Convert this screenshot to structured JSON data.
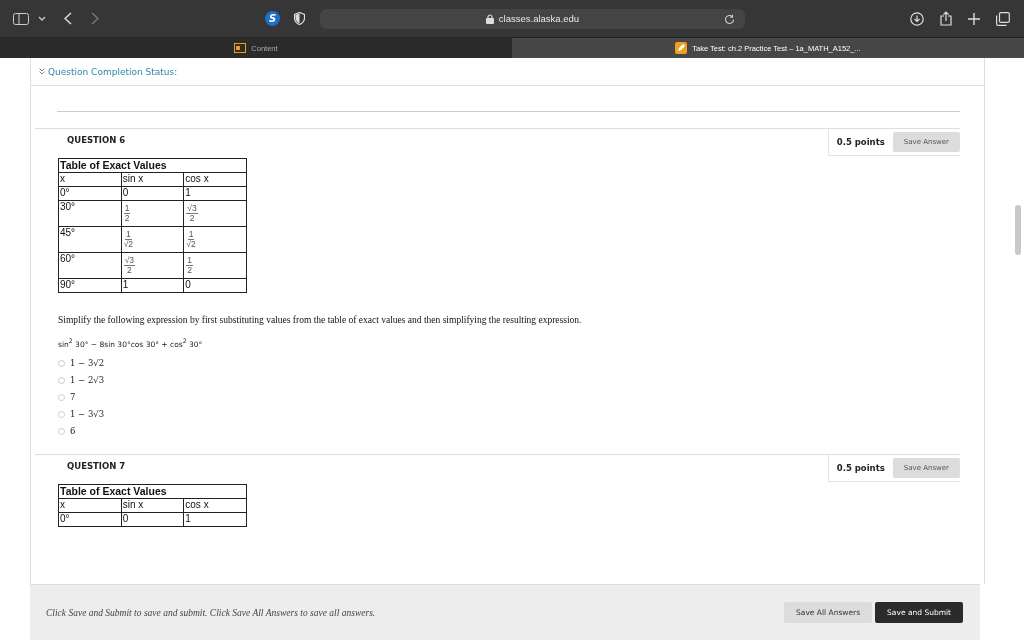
{
  "browser": {
    "extension_badge": "S",
    "address": "classes.alaska.edu",
    "tabs": [
      {
        "label": "Content",
        "selected": false
      },
      {
        "label": "Take Test: ch.2 Practice Test – 1a_MATH_A152_...",
        "selected": true
      }
    ]
  },
  "completion_status": "Question Completion Status:",
  "questions": [
    {
      "title": "QUESTION 6",
      "points": "0.5 points",
      "save_button": "Save Answer",
      "table": {
        "title": "Table of Exact Values",
        "header": [
          "x",
          "sin x",
          "cos x"
        ],
        "rows": [
          [
            {
              "text": "0°"
            },
            {
              "text": "0"
            },
            {
              "text": "1"
            }
          ],
          [
            {
              "text": "30°"
            },
            {
              "num": "1",
              "den": "2"
            },
            {
              "num": "√3",
              "den": "2"
            }
          ],
          [
            {
              "text": "45°"
            },
            {
              "num": "1",
              "den": "√2"
            },
            {
              "num": "1",
              "den": "√2"
            }
          ],
          [
            {
              "text": "60°"
            },
            {
              "num": "√3",
              "den": "2"
            },
            {
              "num": "1",
              "den": "2"
            }
          ],
          [
            {
              "text": "90°"
            },
            {
              "text": "1"
            },
            {
              "text": "0"
            }
          ]
        ]
      },
      "prompt": "Simplify the following expression by first substituting values from the table of exact values and then simplifying the resulting expression.",
      "expression": "sin$^{2}$ 30° − 8sin 30°cos 30° + cos$^{2}$ 30°",
      "options": [
        {
          "label": "1 − 3√2",
          "selected": false
        },
        {
          "label": "1 − 2√3",
          "selected": false
        },
        {
          "label": "7",
          "selected": false
        },
        {
          "label": "1 − 3√3",
          "selected": false
        },
        {
          "label": "6",
          "selected": false
        }
      ]
    },
    {
      "title": "QUESTION 7",
      "points": "0.5 points",
      "save_button": "Save Answer",
      "table": {
        "title": "Table of Exact Values",
        "header": [
          "x",
          "sin x",
          "cos x"
        ],
        "rows": [
          [
            {
              "text": "0°"
            },
            {
              "text": "0"
            },
            {
              "text": "1"
            }
          ]
        ]
      }
    }
  ],
  "footer": {
    "note": "Click Save and Submit to save and submit. Click Save All Answers to save all answers.",
    "buttons": [
      "Save All Answers",
      "Save and Submit"
    ]
  }
}
